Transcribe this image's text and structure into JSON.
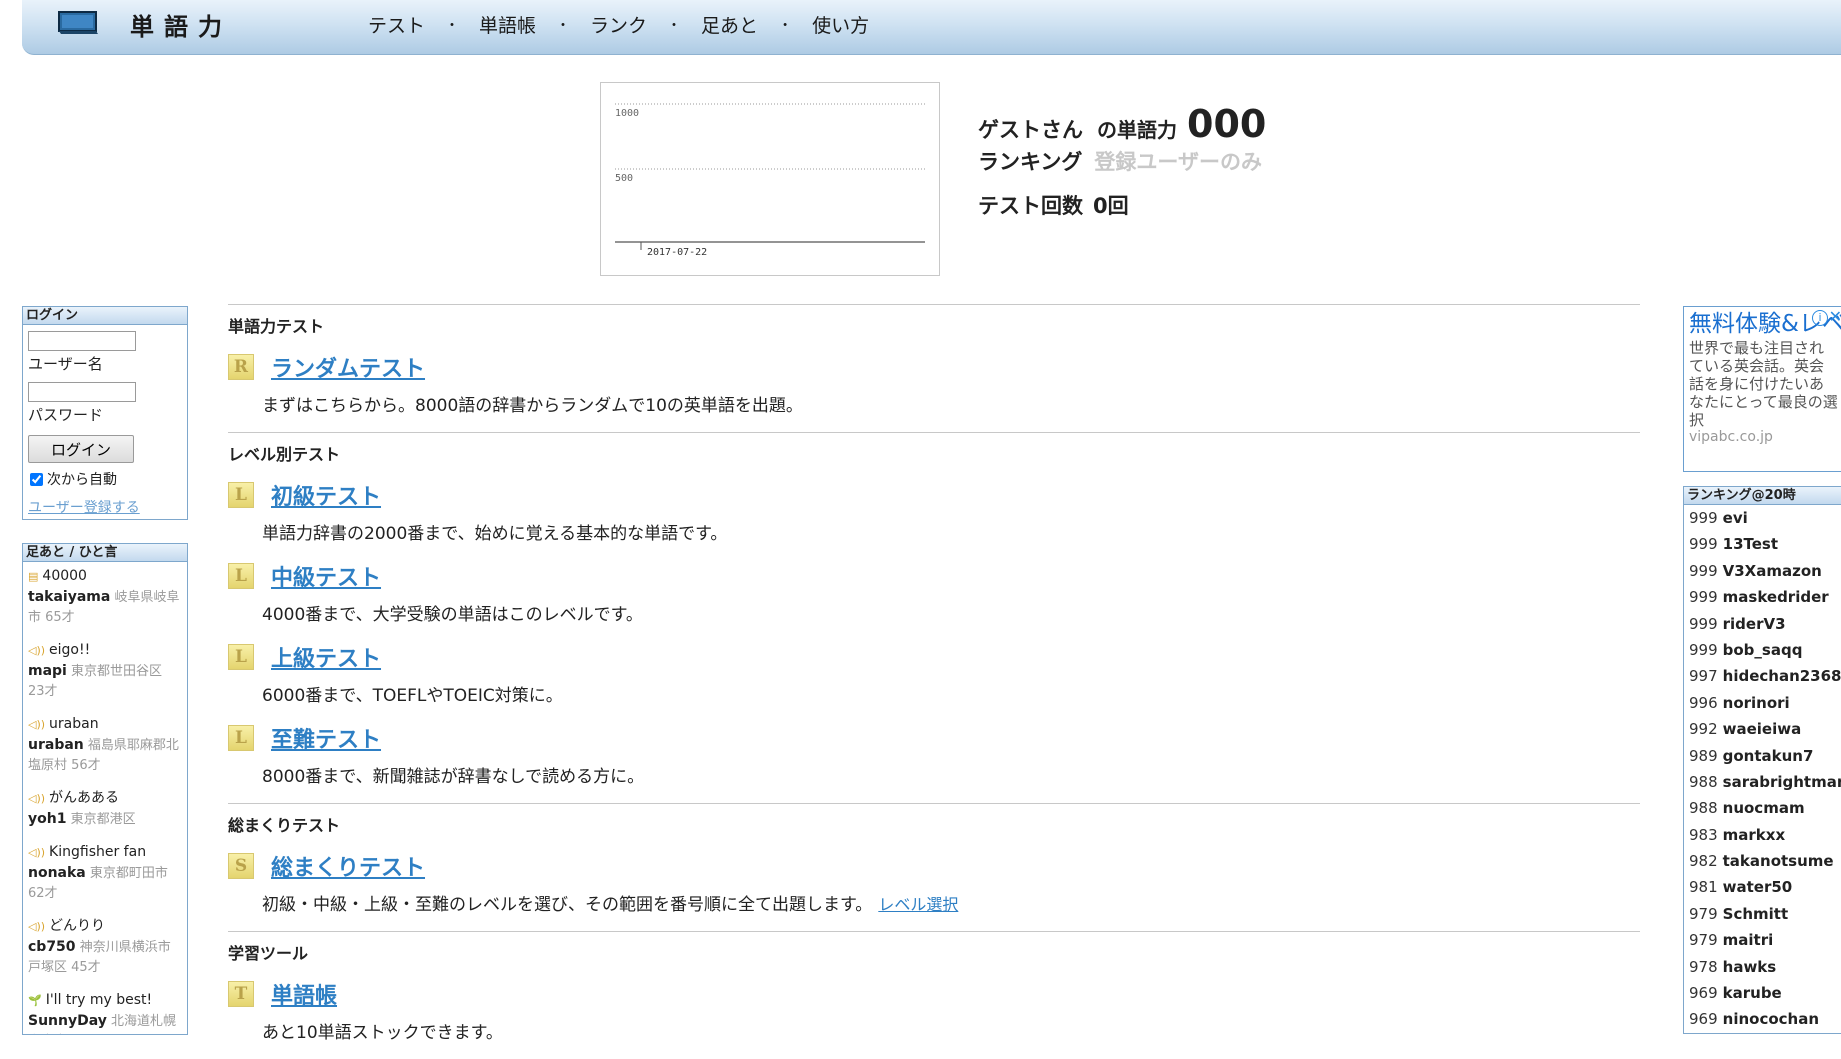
{
  "header": {
    "logo_text": "単語力",
    "nav": [
      "テスト",
      "単語帳",
      "ランク",
      "足あと",
      "使い方"
    ],
    "nav_separator": "・"
  },
  "graph": {
    "y_ticks": [
      "1000",
      "500"
    ],
    "date_label": "2017-07-22"
  },
  "stats": {
    "user": "ゲストさん",
    "vocab_label": "の単語力",
    "vocab_value": "000",
    "ranking_label": "ランキング",
    "ranking_value": "登録ユーザーのみ",
    "tests_label": "テスト回数",
    "tests_value": "0回"
  },
  "login": {
    "title": "ログイン",
    "username_label": "ユーザー名",
    "password_label": "パスワード",
    "button": "ログイン",
    "remember_label": "次から自動",
    "register_link": "ユーザー登録する"
  },
  "feed": {
    "title": "足あと / ひと言",
    "items": [
      {
        "icon": "▤",
        "msg": "40000",
        "user": "takaiyama",
        "meta": "岐阜県岐阜市 65才"
      },
      {
        "icon": "◁))",
        "msg": "eigo!!",
        "user": "mapi",
        "meta": "東京都世田谷区 23才"
      },
      {
        "icon": "◁))",
        "msg": "uraban",
        "user": "uraban",
        "meta": "福島県耶麻郡北塩原村 56才"
      },
      {
        "icon": "◁))",
        "msg": "がんあある",
        "user": "yoh1",
        "meta": "東京都港区"
      },
      {
        "icon": "◁))",
        "msg": "Kingfisher fan",
        "user": "nonaka",
        "meta": "東京都町田市 62才"
      },
      {
        "icon": "◁))",
        "msg": "どんりり",
        "user": "cb750",
        "meta": "神奈川県横浜市戸塚区 45才"
      },
      {
        "icon": "🌱",
        "msg": "I'll try my best!",
        "user": "SunnyDay",
        "meta": "北海道札幌市中央区"
      }
    ]
  },
  "main": {
    "sections": [
      {
        "title": "単語力テスト",
        "entries": [
          {
            "badge": "R",
            "link": "ランダムテスト",
            "desc": "まずはこちらから。8000語の辞書からランダムで10の英単語を出題。"
          }
        ]
      },
      {
        "title": "レベル別テスト",
        "entries": [
          {
            "badge": "L",
            "link": "初級テスト",
            "desc": "単語力辞書の2000番まで、始めに覚える基本的な単語です。"
          },
          {
            "badge": "L",
            "link": "中級テスト",
            "desc": "4000番まで、大学受験の単語はこのレベルです。"
          },
          {
            "badge": "L",
            "link": "上級テスト",
            "desc": "6000番まで、TOEFLやTOEIC対策に。"
          },
          {
            "badge": "L",
            "link": "至難テスト",
            "desc": "8000番まで、新聞雑誌が辞書なしで読める方に。"
          }
        ]
      },
      {
        "title": "総まくりテスト",
        "entries": [
          {
            "badge": "S",
            "link": "総まくりテスト",
            "desc": "初級・中級・上級・至難のレベルを選び、その範囲を番号順に全て出題します。",
            "extra_link": "レベル選択"
          }
        ]
      },
      {
        "title": "学習ツール",
        "entries": [
          {
            "badge": "T",
            "link": "単語帳",
            "desc": "あと10単語ストックできます。"
          }
        ]
      }
    ]
  },
  "ad": {
    "title": "無料体験&レベルチェック",
    "body": "世界で最も注目されている英会話。英会話を身に付けたいあなたにとって最良の選択",
    "url": "vipabc.co.jp"
  },
  "ranking": {
    "title": "ランキング@20時",
    "rows": [
      {
        "score": "999",
        "name": "evi"
      },
      {
        "score": "999",
        "name": "13Test"
      },
      {
        "score": "999",
        "name": "V3Xamazon"
      },
      {
        "score": "999",
        "name": "maskedrider"
      },
      {
        "score": "999",
        "name": "riderV3"
      },
      {
        "score": "999",
        "name": "bob_saqq"
      },
      {
        "score": "997",
        "name": "hidechan2368"
      },
      {
        "score": "996",
        "name": "norinori"
      },
      {
        "score": "992",
        "name": "waeieiwa"
      },
      {
        "score": "989",
        "name": "gontakun7"
      },
      {
        "score": "988",
        "name": "sarabrightman"
      },
      {
        "score": "988",
        "name": "nuocmam"
      },
      {
        "score": "983",
        "name": "markxx"
      },
      {
        "score": "982",
        "name": "takanotsume"
      },
      {
        "score": "981",
        "name": "water50"
      },
      {
        "score": "979",
        "name": "Schmitt"
      },
      {
        "score": "979",
        "name": "maitri"
      },
      {
        "score": "978",
        "name": "hawks"
      },
      {
        "score": "969",
        "name": "karube"
      },
      {
        "score": "969",
        "name": "ninocochan"
      }
    ]
  }
}
